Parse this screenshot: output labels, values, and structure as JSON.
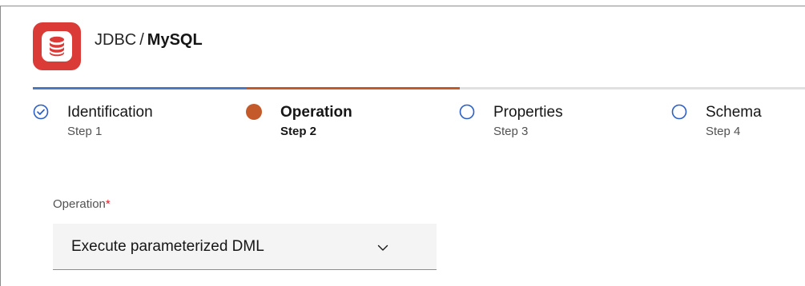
{
  "header": {
    "app_icon": "database-icon",
    "category": "JDBC",
    "separator": "/",
    "name": "MySQL"
  },
  "colors": {
    "brand_red": "#da3b36",
    "completed_blue": "#4a78c2",
    "active_orange": "#c4592a",
    "pending_blue": "#0f62fe",
    "track": "#e0e0e0"
  },
  "steps": [
    {
      "label": "Identification",
      "sub": "Step 1",
      "state": "completed",
      "icon": "check-circle-icon"
    },
    {
      "label": "Operation",
      "sub": "Step 2",
      "state": "active",
      "icon": "filled-circle-icon"
    },
    {
      "label": "Properties",
      "sub": "Step 3",
      "state": "pending",
      "icon": "empty-circle-icon"
    },
    {
      "label": "Schema",
      "sub": "Step 4",
      "state": "pending",
      "icon": "empty-circle-icon"
    }
  ],
  "form": {
    "operation_label": "Operation",
    "required_mark": "*",
    "operation_value": "Execute parameterized DML",
    "dropdown_icon": "chevron-down-icon"
  }
}
